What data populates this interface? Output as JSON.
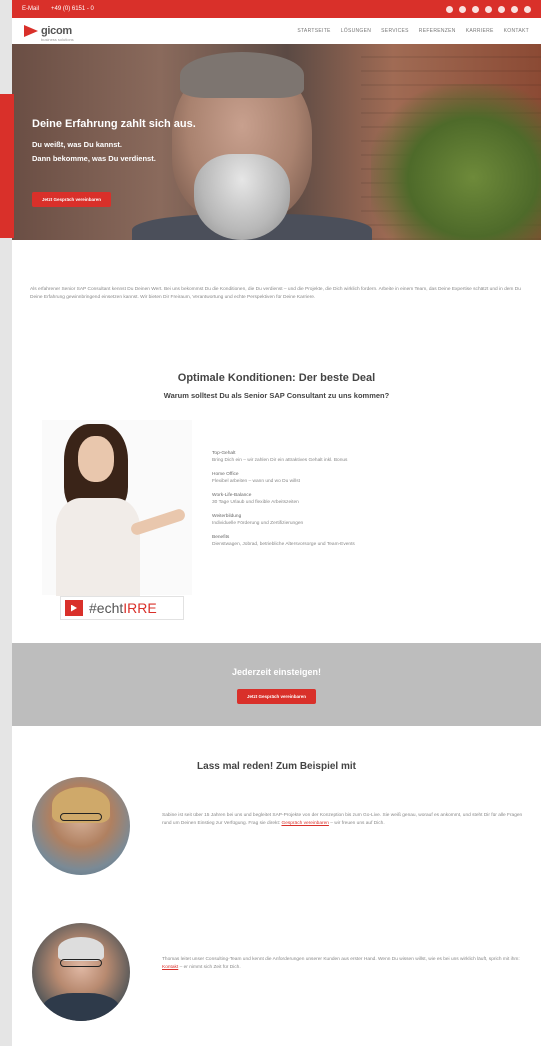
{
  "topbar": {
    "contact_email": "E-Mail",
    "contact_phone": "+49 (0) 6151 - 0",
    "social_icons": [
      "linkedin-icon",
      "xing-icon",
      "facebook-icon",
      "instagram-icon",
      "youtube-icon",
      "twitter-icon",
      "mail-icon"
    ]
  },
  "header": {
    "logo_text": "gicom",
    "logo_sub": "business solutions",
    "nav": [
      "STARTSEITE",
      "LÖSUNGEN",
      "SERVICES",
      "REFERENZEN",
      "KARRIERE",
      "KONTAKT"
    ]
  },
  "hero": {
    "title": "Deine Erfahrung zahlt sich aus.",
    "line1": "Du weißt, was Du kannst.",
    "line2": "Dann bekomme, was Du verdienst.",
    "button": "Jetzt Gespräch vereinbaren"
  },
  "intro": {
    "text": "Als erfahrener Senior SAP Consultant kennst Du Deinen Wert. Bei uns bekommst Du die Konditionen, die Du verdienst – und die Projekte, die Dich wirklich fordern. Arbeite in einem Team, das Deine Expertise schätzt und in dem Du Deine Erfahrung gewinnbringend einsetzen kannst. Wir bieten Dir Freiraum, Verantwortung und echte Perspektiven für Deine Karriere."
  },
  "conditions": {
    "title": "Optimale Konditionen: Der beste Deal",
    "subtitle": "Warum solltest Du als Senior SAP Consultant zu uns kommen?",
    "tag_prefix": "#echt",
    "tag_highlight": "IRRE",
    "benefits": [
      {
        "head": "Top-Gehalt",
        "text": "Bring Dich ein – wir zahlen Dir ein attraktives Gehalt inkl. Bonus"
      },
      {
        "head": "Home Office",
        "text": "Flexibel arbeiten – wann und wo Du willst"
      },
      {
        "head": "Work-Life-Balance",
        "text": "30 Tage Urlaub und flexible Arbeitszeiten"
      },
      {
        "head": "Weiterbildung",
        "text": "Individuelle Förderung und Zertifizierungen"
      },
      {
        "head": "Benefits",
        "text": "Dienstwagen, Jobrad, betriebliche Altersvorsorge und Team-Events"
      }
    ]
  },
  "cta": {
    "title": "Jederzeit einsteigen!",
    "button": "Jetzt Gespräch vereinbaren"
  },
  "testimonials": {
    "title": "Lass mal reden! Zum Beispiel mit",
    "items": [
      {
        "text_before": "Sabine ist seit über 15 Jahren bei uns und begleitet SAP-Projekte von der Konzeption bis zum Go-Live. Sie weiß genau, worauf es ankommt, und steht Dir für alle Fragen rund um Deinen Einstieg zur Verfügung. Frag sie direkt:",
        "link": "Gespräch vereinbaren",
        "text_after": "– wir freuen uns auf Dich."
      },
      {
        "text_before": "Thomas leitet unser Consulting-Team und kennt die Anforderungen unserer Kunden aus erster Hand. Wenn Du wissen willst, wie es bei uns wirklich läuft, sprich mit ihm:",
        "link": "Kontakt",
        "text_after": "– er nimmt sich Zeit für Dich."
      }
    ]
  }
}
